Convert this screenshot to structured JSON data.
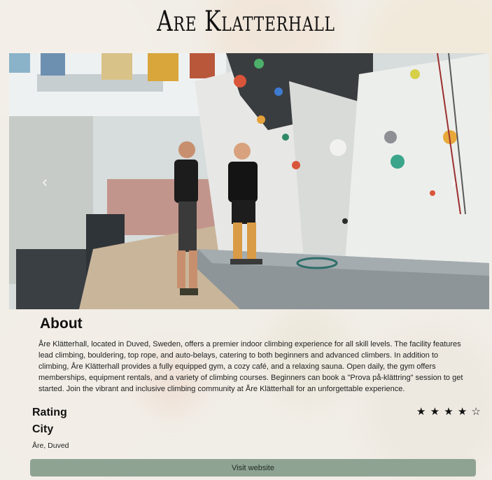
{
  "page": {
    "title": "Are Klatterhall"
  },
  "carousel": {
    "image_alt": "Two climbers talking in an indoor climbing hall",
    "prev_icon": "chevron-left-icon",
    "next_icon": "chevron-right-icon"
  },
  "about": {
    "heading": "About",
    "text": "Åre Klätterhall, located in Duved, Sweden, offers a premier indoor climbing experience for all skill levels. The facility features lead climbing, bouldering, top rope, and auto-belays, catering to both beginners and advanced climbers. In addition to climbing, Åre Klätterhall provides a fully equipped gym, a cozy café, and a relaxing sauna. Open daily, the gym offers memberships, equipment rentals, and a variety of climbing courses. Beginners can book a \"Prova på-klättring\" session to get started. Join the vibrant and inclusive climbing community at Åre Klätterhall for an unforgettable experience."
  },
  "rating": {
    "label": "Rating",
    "value": 4,
    "max": 5
  },
  "city": {
    "label": "City",
    "value": "Åre, Duved"
  },
  "actions": {
    "visit_label": "Visit website"
  },
  "colors": {
    "button": "#8fa392",
    "mat": "#8d9599",
    "wall": "#e3e4e2"
  }
}
